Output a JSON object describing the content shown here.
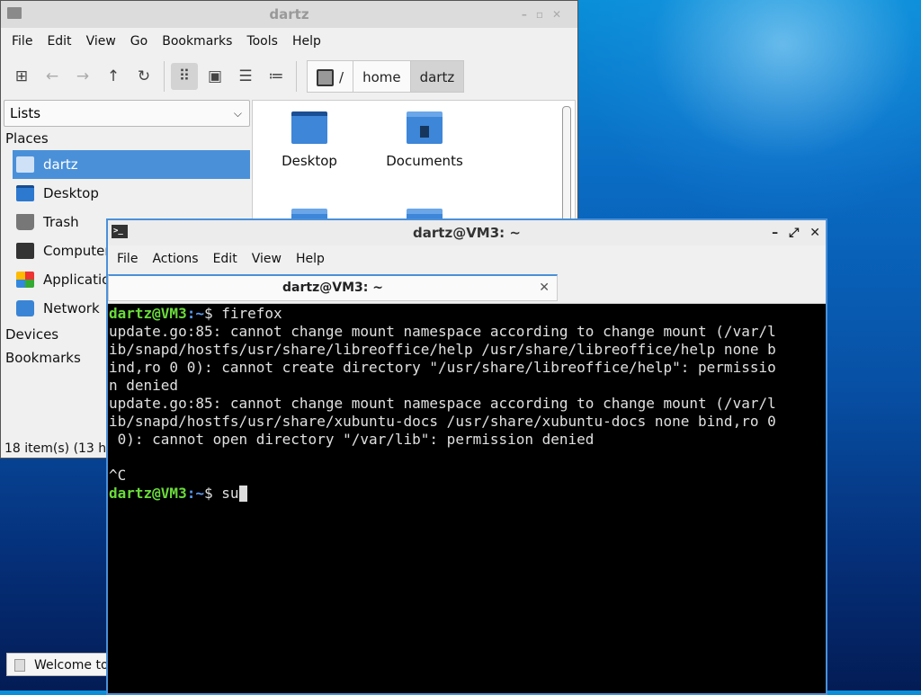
{
  "file_manager": {
    "title": "dartz",
    "menu": [
      "File",
      "Edit",
      "View",
      "Go",
      "Bookmarks",
      "Tools",
      "Help"
    ],
    "path": [
      "/",
      "home",
      "dartz"
    ],
    "side_view": "Lists",
    "places_label": "Places",
    "places": [
      {
        "label": "dartz",
        "icon": "home-folder-icon",
        "selected": true
      },
      {
        "label": "Desktop",
        "icon": "desktop-icon",
        "selected": false
      },
      {
        "label": "Trash",
        "icon": "trash-icon",
        "selected": false
      },
      {
        "label": "Computer",
        "icon": "computer-icon",
        "selected": false
      },
      {
        "label": "Applicatio",
        "icon": "applications-icon",
        "selected": false
      },
      {
        "label": "Network",
        "icon": "network-icon",
        "selected": false
      }
    ],
    "devices_label": "Devices",
    "bookmarks_label": "Bookmarks",
    "files": [
      {
        "label": "Desktop",
        "icon": "desktop-folder-icon"
      },
      {
        "label": "Documents",
        "icon": "documents-folder-icon"
      }
    ],
    "status": "18 item(s) (13 hi"
  },
  "taskbar": {
    "item_label": "Welcome to"
  },
  "terminal": {
    "title": "dartz@VM3: ~",
    "menu": [
      "File",
      "Actions",
      "Edit",
      "View",
      "Help"
    ],
    "tab_title": "dartz@VM3: ~",
    "prompt_user": "dartz@VM3",
    "prompt_path": ":~",
    "prompt_symbol": "$ ",
    "command1": "firefox",
    "output": [
      "update.go:85: cannot change mount namespace according to change mount (/var/l",
      "ib/snapd/hostfs/usr/share/libreoffice/help /usr/share/libreoffice/help none b",
      "ind,ro 0 0): cannot create directory \"/usr/share/libreoffice/help\": permissio",
      "n denied",
      "update.go:85: cannot change mount namespace according to change mount (/var/l",
      "ib/snapd/hostfs/usr/share/xubuntu-docs /usr/share/xubuntu-docs none bind,ro 0",
      " 0): cannot open directory \"/var/lib\": permission denied",
      "",
      "^C"
    ],
    "command2": "su"
  }
}
